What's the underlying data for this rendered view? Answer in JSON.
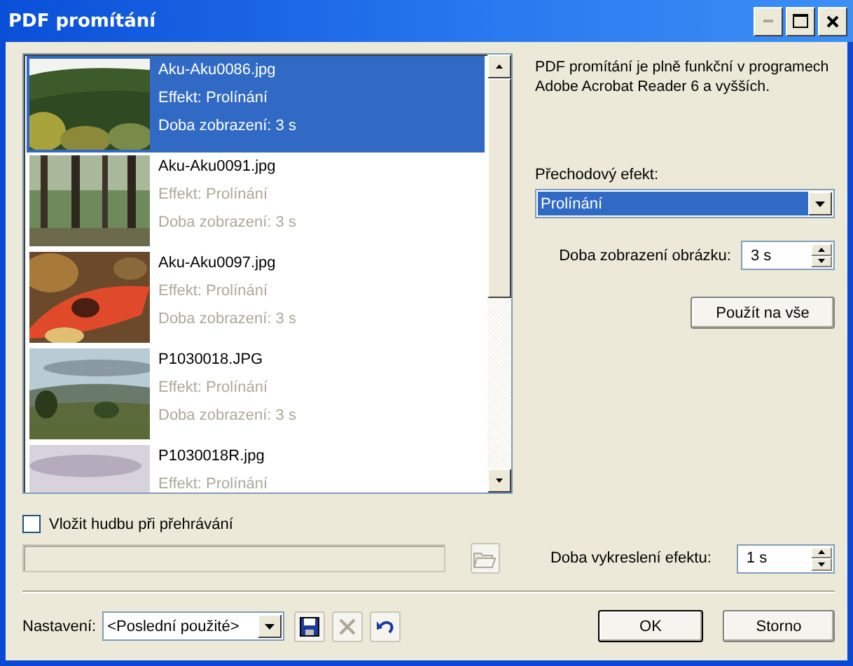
{
  "window": {
    "title": "PDF promítání"
  },
  "window_controls": [
    {
      "kind": "minimize",
      "disabled": true
    },
    {
      "kind": "maximize",
      "disabled": false
    },
    {
      "kind": "close",
      "disabled": false
    }
  ],
  "slides": [
    {
      "name": "Aku-Aku0086.jpg",
      "effect": "Effekt: Prolínání",
      "duration": "Doba zobrazení: 3 s",
      "selected": true
    },
    {
      "name": "Aku-Aku0091.jpg",
      "effect": "Effekt: Prolínání",
      "duration": "Doba zobrazení: 3 s",
      "selected": false
    },
    {
      "name": "Aku-Aku0097.jpg",
      "effect": "Effekt: Prolínání",
      "duration": "Doba zobrazení: 3 s",
      "selected": false
    },
    {
      "name": "P1030018.JPG",
      "effect": "Effekt: Prolínání",
      "duration": "Doba zobrazení: 3 s",
      "selected": false
    },
    {
      "name": "P1030018R.jpg",
      "effect": "Effekt: Prolínání",
      "selected": false
    }
  ],
  "info_text": "PDF promítání je plně funkční v programech Adobe Acrobat Reader 6 a vyšších.",
  "transition": {
    "label": "Přechodový efekt:",
    "value": "Prolínání"
  },
  "display_time": {
    "label": "Doba zobrazení obrázku:",
    "value": "3 s"
  },
  "apply_all_button": "Použít na vše",
  "music": {
    "label": "Vložit hudbu při přehrávání",
    "checked": false
  },
  "music_path": {
    "disabled": true
  },
  "browse_button": {
    "disabled": true
  },
  "effect_time": {
    "label": "Doba vykreslení efektu:",
    "value": "1 s"
  },
  "preset": {
    "label": "Nastavení:",
    "value": "<Poslední použité>"
  },
  "preset_tools": [
    {
      "kind": "save",
      "disabled": false
    },
    {
      "kind": "delete",
      "disabled": true
    },
    {
      "kind": "undo",
      "disabled": false
    }
  ],
  "buttons": [
    {
      "label": "OK",
      "default": true
    },
    {
      "label": "Storno",
      "default": false
    }
  ]
}
